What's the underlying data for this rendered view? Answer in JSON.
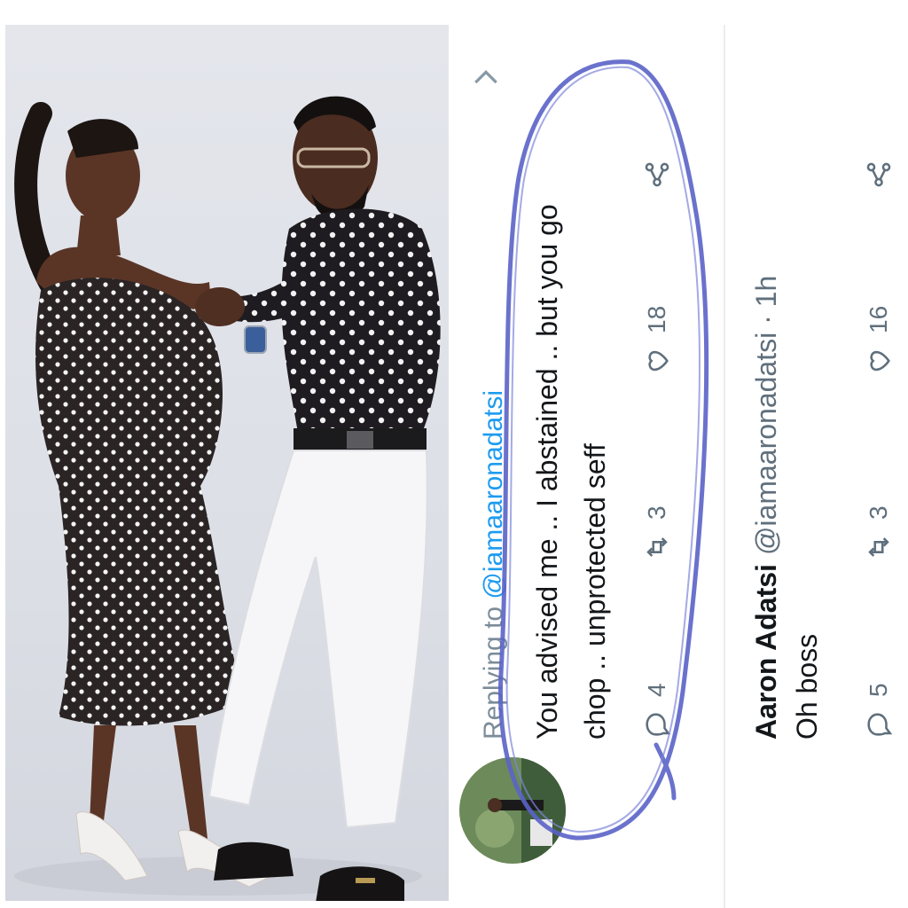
{
  "tweet1": {
    "reply_prefix": "Replying to ",
    "reply_handle": "@iamaaronadatsi",
    "body_line1": "You advised me .. I abstained .. but you go",
    "body_line2": "chop .. unprotected seff",
    "reply_count": "4",
    "retweet_count": "3",
    "like_count": "18"
  },
  "tweet2": {
    "author_name": "Aaron Adatsi",
    "author_meta": "@iamaaronadatsi · 1h",
    "body": "Oh boss",
    "reply_count": "5",
    "retweet_count": "3",
    "like_count": "16"
  },
  "colors": {
    "highlight_ink": "#5a63c8",
    "handle_blue": "#1d9bf0",
    "icon_gray": "#5f6f7c"
  },
  "icons": [
    "reply-icon",
    "retweet-icon",
    "like-icon",
    "share-icon",
    "chevron-right-icon"
  ]
}
